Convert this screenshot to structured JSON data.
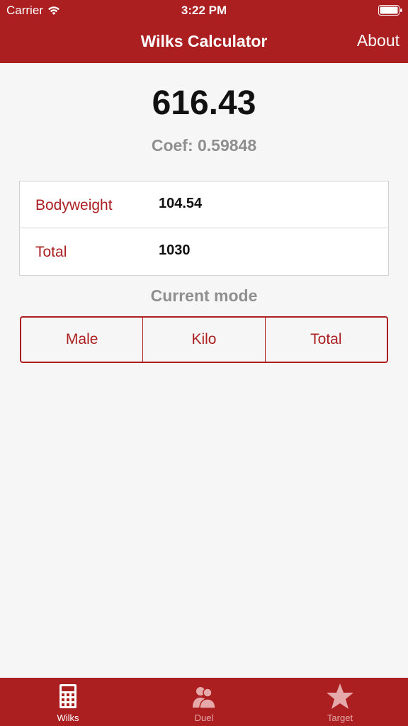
{
  "status_bar": {
    "carrier": "Carrier",
    "time": "3:22 PM"
  },
  "nav": {
    "title": "Wilks Calculator",
    "about_label": "About"
  },
  "result": {
    "score": "616.43",
    "coef": "Coef: 0.59848"
  },
  "form": {
    "bodyweight_label": "Bodyweight",
    "bodyweight_value": "104.54",
    "total_label": "Total",
    "total_value": "1030"
  },
  "mode": {
    "title": "Current mode",
    "segments": [
      "Male",
      "Kilo",
      "Total"
    ]
  },
  "tabs": [
    {
      "label": "Wilks",
      "icon": "calculator-icon",
      "active": true
    },
    {
      "label": "Duel",
      "icon": "people-icon",
      "active": false
    },
    {
      "label": "Target",
      "icon": "star-icon",
      "active": false
    }
  ],
  "colors": {
    "accent": "#ab1f21",
    "background": "#f6f6f6",
    "muted_text": "#8f8f8f",
    "inactive_tab": "#e5a9aa"
  }
}
